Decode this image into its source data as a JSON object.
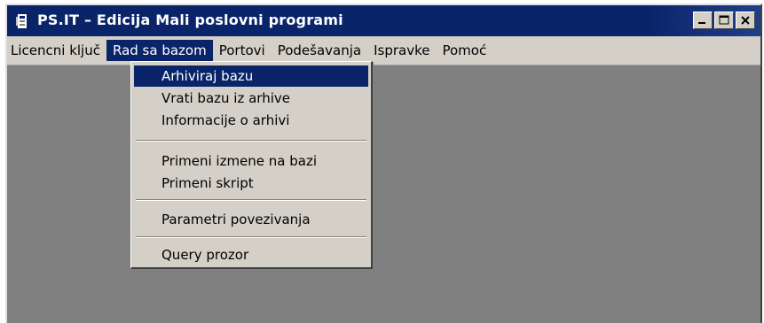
{
  "window": {
    "title": "PS.IT – Edicija Mali poslovni programi",
    "icon": "app-icon",
    "controls": [
      "minimize-icon",
      "maximize-icon",
      "close-icon"
    ]
  },
  "menubar": {
    "items": [
      {
        "label": "Licencni ključ"
      },
      {
        "label": "Rad sa bazom",
        "active": true
      },
      {
        "label": "Portovi"
      },
      {
        "label": "Podešavanja"
      },
      {
        "label": "Ispravke"
      },
      {
        "label": "Pomoć"
      }
    ]
  },
  "dropdown": {
    "items": [
      {
        "label": "Arhiviraj bazu",
        "selected": true
      },
      {
        "label": "Vrati bazu iz arhive"
      },
      {
        "label": "Informacije o arhivi"
      },
      {
        "label": "Primeni izmene na bazi"
      },
      {
        "label": "Primeni skript"
      },
      {
        "label": "Parametri povezivanja"
      },
      {
        "label": "Query prozor"
      }
    ]
  },
  "colors": {
    "titlebar": "#0a246a",
    "menu_face": "#d4d0c8",
    "client_area": "#808080",
    "highlight": "#0a246a"
  }
}
